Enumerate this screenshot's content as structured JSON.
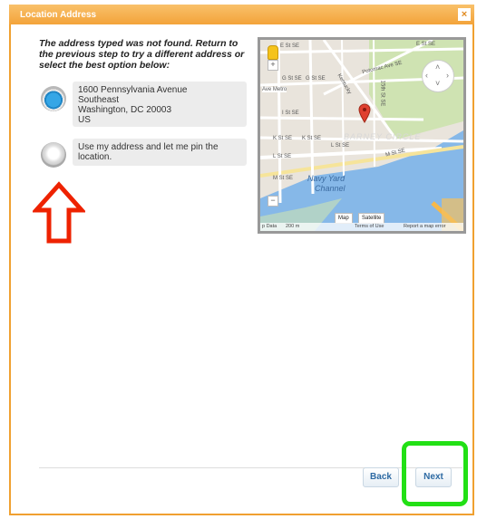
{
  "dialog": {
    "title": "Location Address",
    "close_label": "×"
  },
  "message": "The address typed was not found. Return to the previous step to try a different address or select the best option below:",
  "options": [
    {
      "lines": [
        "1600 Pennsylvania Avenue",
        "Southeast",
        "Washington, DC 20003",
        "US"
      ],
      "selected": true
    },
    {
      "text": "Use my address and let me pin the location.",
      "selected": false
    }
  ],
  "map": {
    "labels": {
      "e_st_se_1": "E St SE",
      "e_st_se_2": "E St SE",
      "potomac_ave": "Potomac Ave SE",
      "g_st_se_1": "G St SE",
      "g_st_se_2": "G St SE",
      "ave_metro": "Ave Metro",
      "kentucky": "Kentucky",
      "th_st": "15th St SE",
      "i_st_se": "I St SE",
      "barney_circle": "BARNEY CIRCLE",
      "k_st_se_1": "K St SE",
      "k_st_se_2": "K St SE",
      "l_st_se_1": "L St SE",
      "l_st_se_2": "L St SE",
      "m_st_se_1": "M St SE",
      "m_st_se_2": "M St SE",
      "navy_yard": "Navy Yard",
      "channel": "Channel"
    },
    "zoom_in": "+",
    "zoom_out": "−",
    "map_type_map": "Map",
    "map_type_satellite": "Satellite",
    "footer": {
      "data": "p Data",
      "scale": "200 m",
      "terms": "Terms of Use",
      "report": "Report a map error"
    },
    "colors": {
      "water": "#86b8e8",
      "park": "#cfe3b2",
      "road": "#ffffff",
      "marker": "#e04030"
    }
  },
  "buttons": {
    "back": "Back",
    "next": "Next"
  },
  "annotation_colors": {
    "red_arrow": "#ee2200",
    "green_box": "#22e015"
  }
}
